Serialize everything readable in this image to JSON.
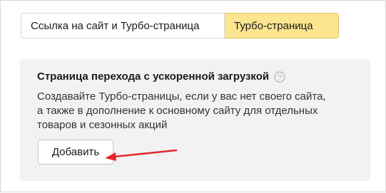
{
  "tabs": [
    {
      "label": "Ссылка на сайт и Турбо-страница",
      "active": false
    },
    {
      "label": "Турбо-страница",
      "active": true
    }
  ],
  "card": {
    "title": "Страница перехода с ускоренной загрузкой",
    "help_icon": "question-circle-icon",
    "description": "Создавайте Турбо-страницы, если у вас нет своего сайта,\nа также в дополнение к основному сайту для отдельных\nтоваров и сезонных акций",
    "add_button_label": "Добавить"
  },
  "colors": {
    "active_tab": "#fbe58f",
    "card_background": "#f2f2f2",
    "arrow": "#e8262a"
  }
}
